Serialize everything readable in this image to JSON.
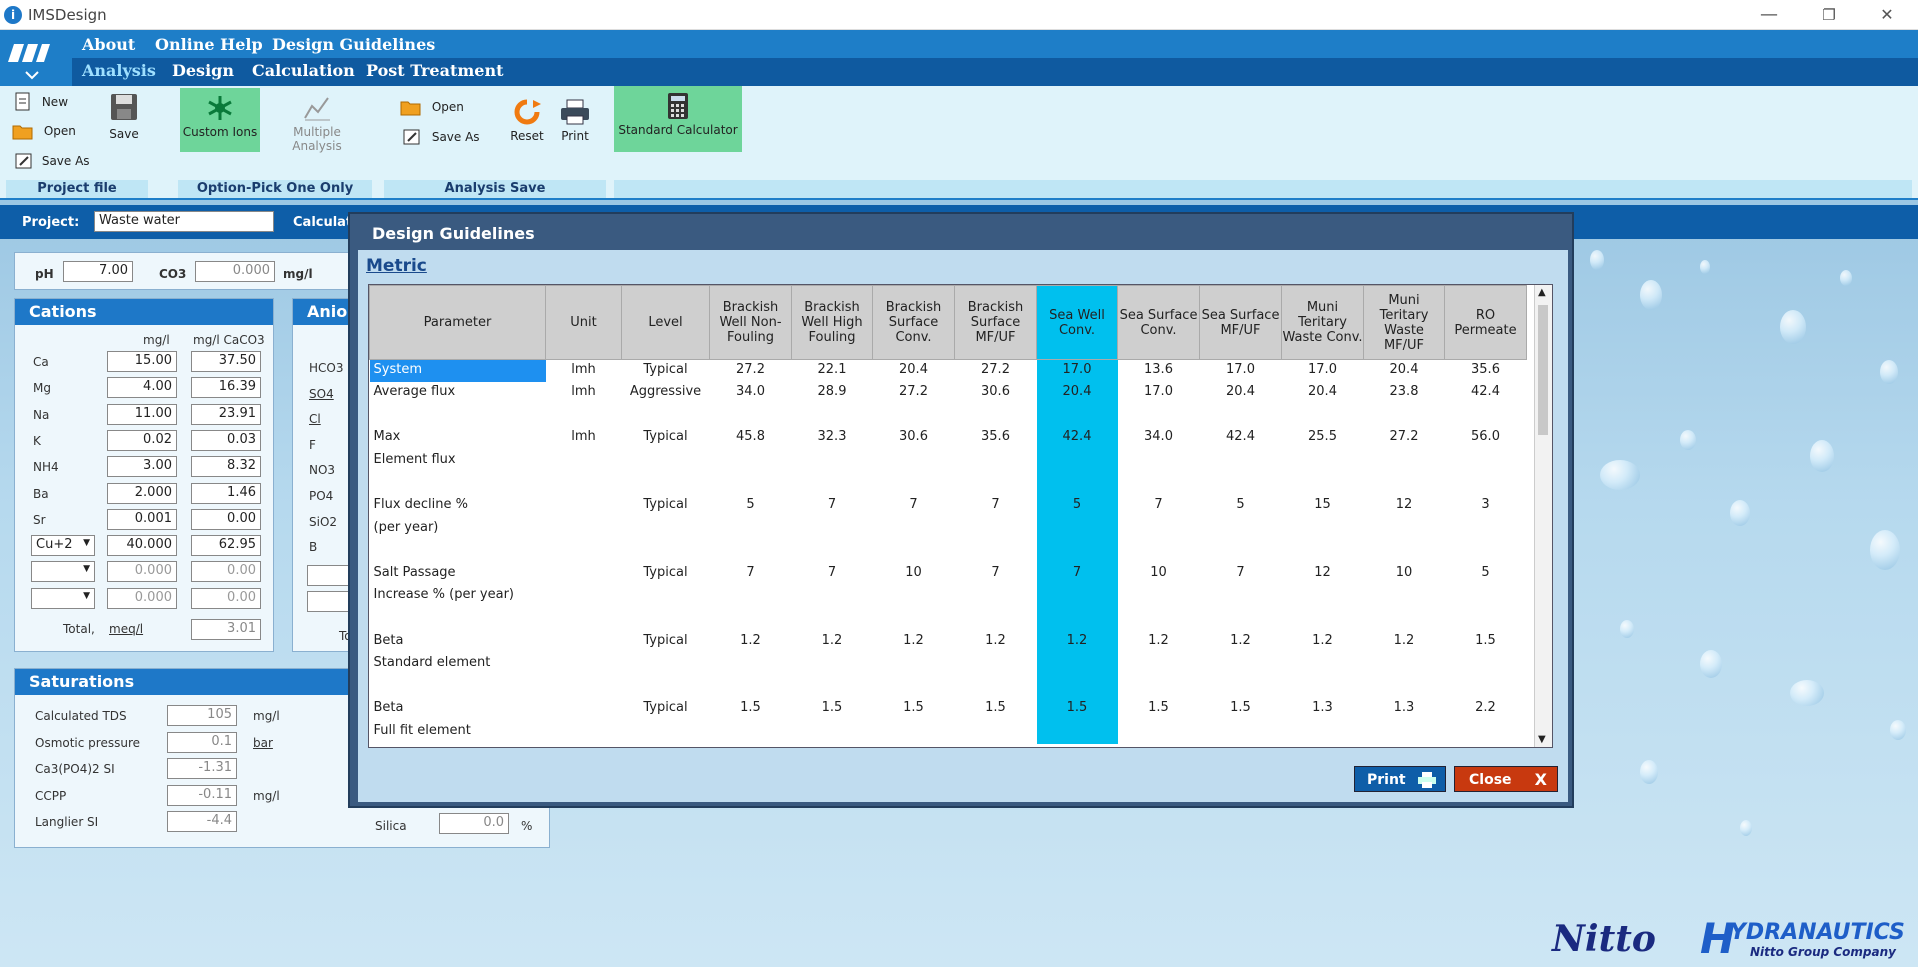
{
  "window": {
    "title": "IMSDesign",
    "min": "—",
    "max": "❐",
    "close": "✕"
  },
  "menu": {
    "top": [
      "About",
      "Online Help",
      "Design Guidelines"
    ],
    "second": [
      "Analysis",
      "Design",
      "Calculation",
      "Post Treatment"
    ]
  },
  "ribbon": {
    "project_file": {
      "new": "New",
      "open": "Open",
      "save_as": "Save As",
      "save": "Save",
      "group": "Project file"
    },
    "option": {
      "custom_ions": "Custom Ions",
      "multiple_analysis": "Multiple Analysis",
      "group": "Option-Pick One Only"
    },
    "analysis_save": {
      "open": "Open",
      "save_as": "Save As",
      "reset": "Reset",
      "print": "Print",
      "group": "Analysis Save"
    },
    "calculator": "Standard Calculator"
  },
  "project": {
    "label": "Project:",
    "value": "Waste water",
    "calculate": "Calculate"
  },
  "water": {
    "ph_label": "pH",
    "ph": "7.00",
    "co3_label": "CO3",
    "co3": "0.000",
    "co3_unit": "mg/l"
  },
  "cations": {
    "title": "Cations",
    "col1": "mg/l",
    "col2": "mg/l CaCO3",
    "rows": [
      {
        "ion": "Ca",
        "mgl": "15.00",
        "caco3": "37.50"
      },
      {
        "ion": "Mg",
        "mgl": "4.00",
        "caco3": "16.39"
      },
      {
        "ion": "Na",
        "mgl": "11.00",
        "caco3": "23.91"
      },
      {
        "ion": "K",
        "mgl": "0.02",
        "caco3": "0.03"
      },
      {
        "ion": "NH4",
        "mgl": "3.00",
        "caco3": "8.32"
      },
      {
        "ion": "Ba",
        "mgl": "2.000",
        "caco3": "1.46"
      },
      {
        "ion": "Sr",
        "mgl": "0.001",
        "caco3": "0.00"
      }
    ],
    "custom": [
      {
        "ion": "Cu+2",
        "mgl": "40.000",
        "caco3": "62.95"
      },
      {
        "ion": "",
        "mgl": "0.000",
        "caco3": "0.00"
      },
      {
        "ion": "",
        "mgl": "0.000",
        "caco3": "0.00"
      }
    ],
    "total_label": "Total,",
    "total_unit": "meq/l",
    "total": "3.01"
  },
  "anions": {
    "title": "Anion",
    "ions": [
      "HCO3",
      "SO4",
      "Cl",
      "F",
      "NO3",
      "PO4",
      "SiO2",
      "B"
    ],
    "total_prefix": "To"
  },
  "saturations": {
    "title": "Saturations",
    "rows": [
      {
        "label": "Calculated TDS",
        "value": "105",
        "unit": "mg/l"
      },
      {
        "label": "Osmotic pressure",
        "value": "0.1",
        "unit": "bar"
      },
      {
        "label": "Ca3(PO4)2 SI",
        "value": "-1.31",
        "unit": ""
      },
      {
        "label": "CCPP",
        "value": "-0.11",
        "unit": "mg/l"
      },
      {
        "label": "Langlier SI",
        "value": "-4.4",
        "unit": ""
      }
    ],
    "silica_label": "Silica",
    "silica": "0.0",
    "silica_unit": "%"
  },
  "dialog": {
    "title": "Design Guidelines",
    "metric": "Metric",
    "headers": [
      "Parameter",
      "Unit",
      "Level",
      "Brackish Well Non-Fouling",
      "Brackish Well High Fouling",
      "Brackish Surface Conv.",
      "Brackish Surface MF/UF",
      "Sea Well Conv.",
      "Sea Surface Conv.",
      "Sea Surface MF/UF",
      "Muni Teritary Waste Conv.",
      "Muni Teritary Waste MF/UF",
      "RO Permeate"
    ],
    "rows": [
      [
        "System",
        "lmh",
        "Typical",
        "27.2",
        "22.1",
        "20.4",
        "27.2",
        "17.0",
        "13.6",
        "17.0",
        "17.0",
        "20.4",
        "35.6"
      ],
      [
        "Average flux",
        "lmh",
        "Aggressive",
        "34.0",
        "28.9",
        "27.2",
        "30.6",
        "20.4",
        "17.0",
        "20.4",
        "20.4",
        "23.8",
        "42.4"
      ],
      [
        "",
        "",
        "",
        "",
        "",
        "",
        "",
        "",
        "",
        "",
        "",
        "",
        ""
      ],
      [
        "Max",
        "lmh",
        "Typical",
        "45.8",
        "32.3",
        "30.6",
        "35.6",
        "42.4",
        "34.0",
        "42.4",
        "25.5",
        "27.2",
        "56.0"
      ],
      [
        "Element flux",
        "",
        "",
        "",
        "",
        "",
        "",
        "",
        "",
        "",
        "",
        "",
        ""
      ],
      [
        "",
        "",
        "",
        "",
        "",
        "",
        "",
        "",
        "",
        "",
        "",
        "",
        ""
      ],
      [
        "Flux decline %",
        "",
        "Typical",
        "5",
        "7",
        "7",
        "7",
        "5",
        "7",
        "5",
        "15",
        "12",
        "3"
      ],
      [
        "(per year)",
        "",
        "",
        "",
        "",
        "",
        "",
        "",
        "",
        "",
        "",
        "",
        ""
      ],
      [
        "",
        "",
        "",
        "",
        "",
        "",
        "",
        "",
        "",
        "",
        "",
        "",
        ""
      ],
      [
        "Salt Passage",
        "",
        "Typical",
        "7",
        "7",
        "10",
        "7",
        "7",
        "10",
        "7",
        "12",
        "10",
        "5"
      ],
      [
        "Increase % (per year)",
        "",
        "",
        "",
        "",
        "",
        "",
        "",
        "",
        "",
        "",
        "",
        ""
      ],
      [
        "",
        "",
        "",
        "",
        "",
        "",
        "",
        "",
        "",
        "",
        "",
        "",
        ""
      ],
      [
        "Beta",
        "",
        "Typical",
        "1.2",
        "1.2",
        "1.2",
        "1.2",
        "1.2",
        "1.2",
        "1.2",
        "1.2",
        "1.2",
        "1.5"
      ],
      [
        "Standard element",
        "",
        "",
        "",
        "",
        "",
        "",
        "",
        "",
        "",
        "",
        "",
        ""
      ],
      [
        "",
        "",
        "",
        "",
        "",
        "",
        "",
        "",
        "",
        "",
        "",
        "",
        ""
      ],
      [
        "Beta",
        "",
        "Typical",
        "1.5",
        "1.5",
        "1.5",
        "1.5",
        "1.5",
        "1.5",
        "1.5",
        "1.3",
        "1.3",
        "2.2"
      ],
      [
        "Full fit element",
        "",
        "",
        "",
        "",
        "",
        "",
        "",
        "",
        "",
        "",
        "",
        ""
      ]
    ],
    "print": "Print",
    "close": "Close"
  },
  "brand": {
    "nitto": "Nitto",
    "hydranautics": "YDRANAUTICS",
    "h": "H",
    "sub": "Nitto Group Company"
  },
  "colors": {
    "accent": "#1e7ec8",
    "highlight": "#00c0ee",
    "ribbon": "#dff3fa"
  }
}
